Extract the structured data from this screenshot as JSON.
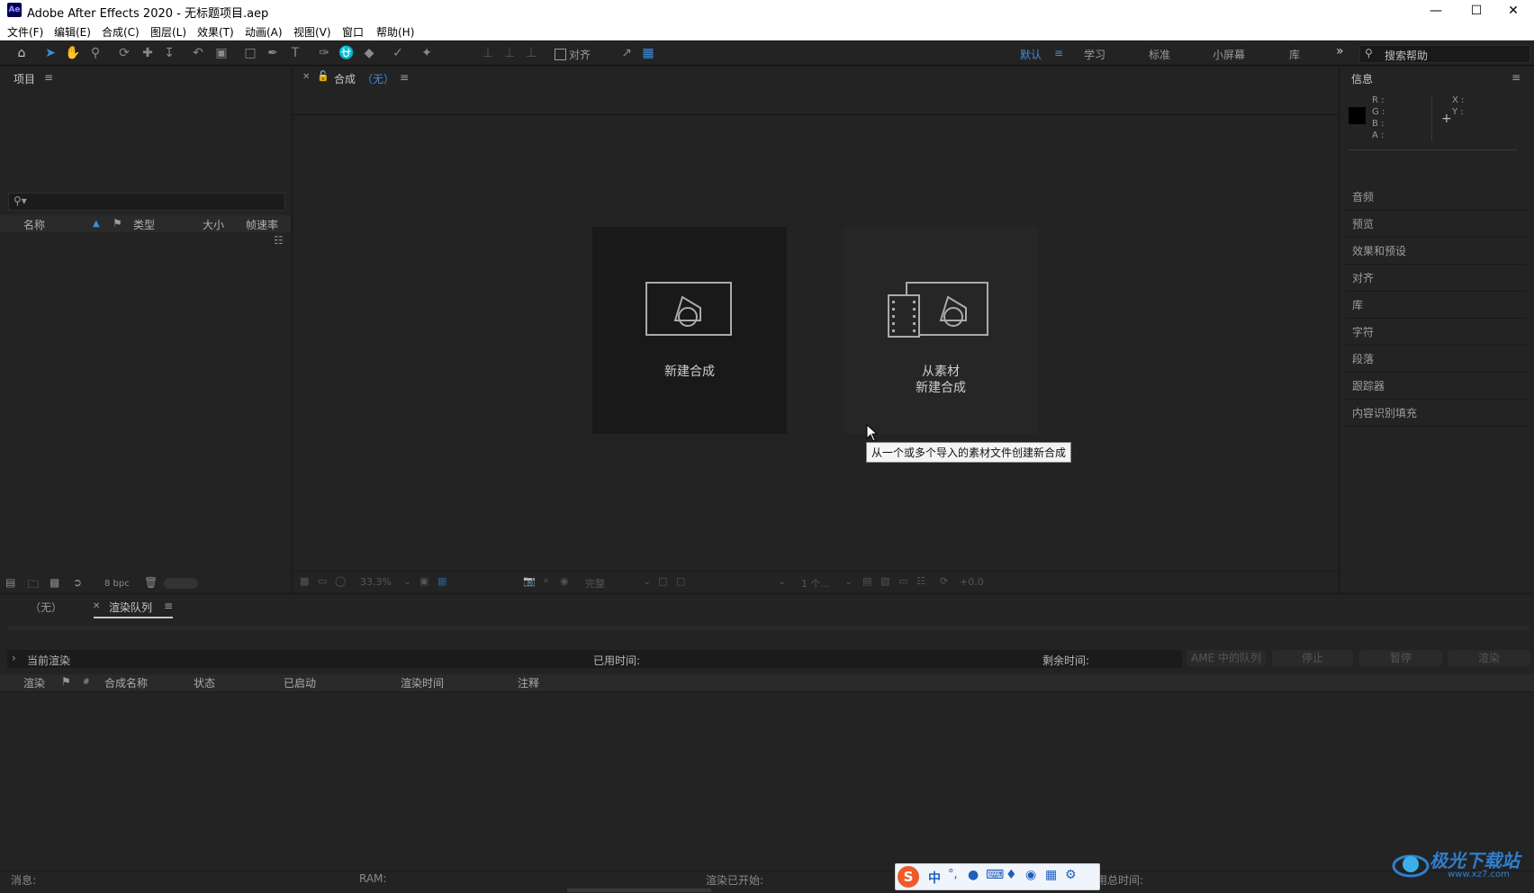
{
  "window": {
    "app_icon": "Ae",
    "title": "Adobe After Effects 2020 - 无标题项目.aep",
    "controls": [
      "minimize-icon",
      "maximize-icon",
      "close-icon"
    ]
  },
  "menu": [
    "文件(F)",
    "编辑(E)",
    "合成(C)",
    "图层(L)",
    "效果(T)",
    "动画(A)",
    "视图(V)",
    "窗口",
    "帮助(H)"
  ],
  "toolbar": {
    "snap_label": "对齐",
    "workspaces": [
      {
        "label": "默认",
        "active": true
      },
      {
        "label": "学习",
        "active": false
      },
      {
        "label": "标准",
        "active": false
      },
      {
        "label": "小屏幕",
        "active": false
      },
      {
        "label": "库",
        "active": false
      }
    ],
    "overflow": "»",
    "search_placeholder": "搜索帮助"
  },
  "project_panel": {
    "title": "项目",
    "columns": [
      "名称",
      "类型",
      "大小",
      "帧速率"
    ],
    "bpc": "8 bpc"
  },
  "comp_panel": {
    "tab_label": "合成",
    "tab_value": "（无）",
    "cards": [
      {
        "line1": "新建合成",
        "line2": ""
      },
      {
        "line1": "从素材",
        "line2": "新建合成"
      }
    ],
    "tooltip": "从一个或多个导入的素材文件创建新合成",
    "footer": {
      "zoom": "33.3%",
      "quality": "完整",
      "views": "1 个...",
      "exposure": "+0.0"
    }
  },
  "info_panel": {
    "title": "信息",
    "color_labels": [
      "R :",
      "G :",
      "B :",
      "A :"
    ],
    "coord_labels": [
      "X :",
      "Y :"
    ]
  },
  "side_panels": [
    "音频",
    "预览",
    "效果和预设",
    "对齐",
    "库",
    "字符",
    "段落",
    "跟踪器",
    "内容识别填充"
  ],
  "bottom": {
    "tab_none": "（无）",
    "tab_render": "渲染队列",
    "current_render": "当前渲染",
    "elapsed": "已用时间:",
    "remaining": "剩余时间:",
    "buttons": [
      "AME 中的队列",
      "停止",
      "暂停",
      "渲染"
    ],
    "columns": [
      "渲染",
      "#",
      "合成名称",
      "状态",
      "已启动",
      "渲染时间",
      "注释"
    ]
  },
  "status_bar": {
    "message": "消息:",
    "ram": "RAM:",
    "started": "渲染已开始:",
    "total": "已用总时间:"
  },
  "ime": {
    "mode": "中"
  },
  "watermark": {
    "text": "极光下载站",
    "url": "www.xz7.com"
  }
}
